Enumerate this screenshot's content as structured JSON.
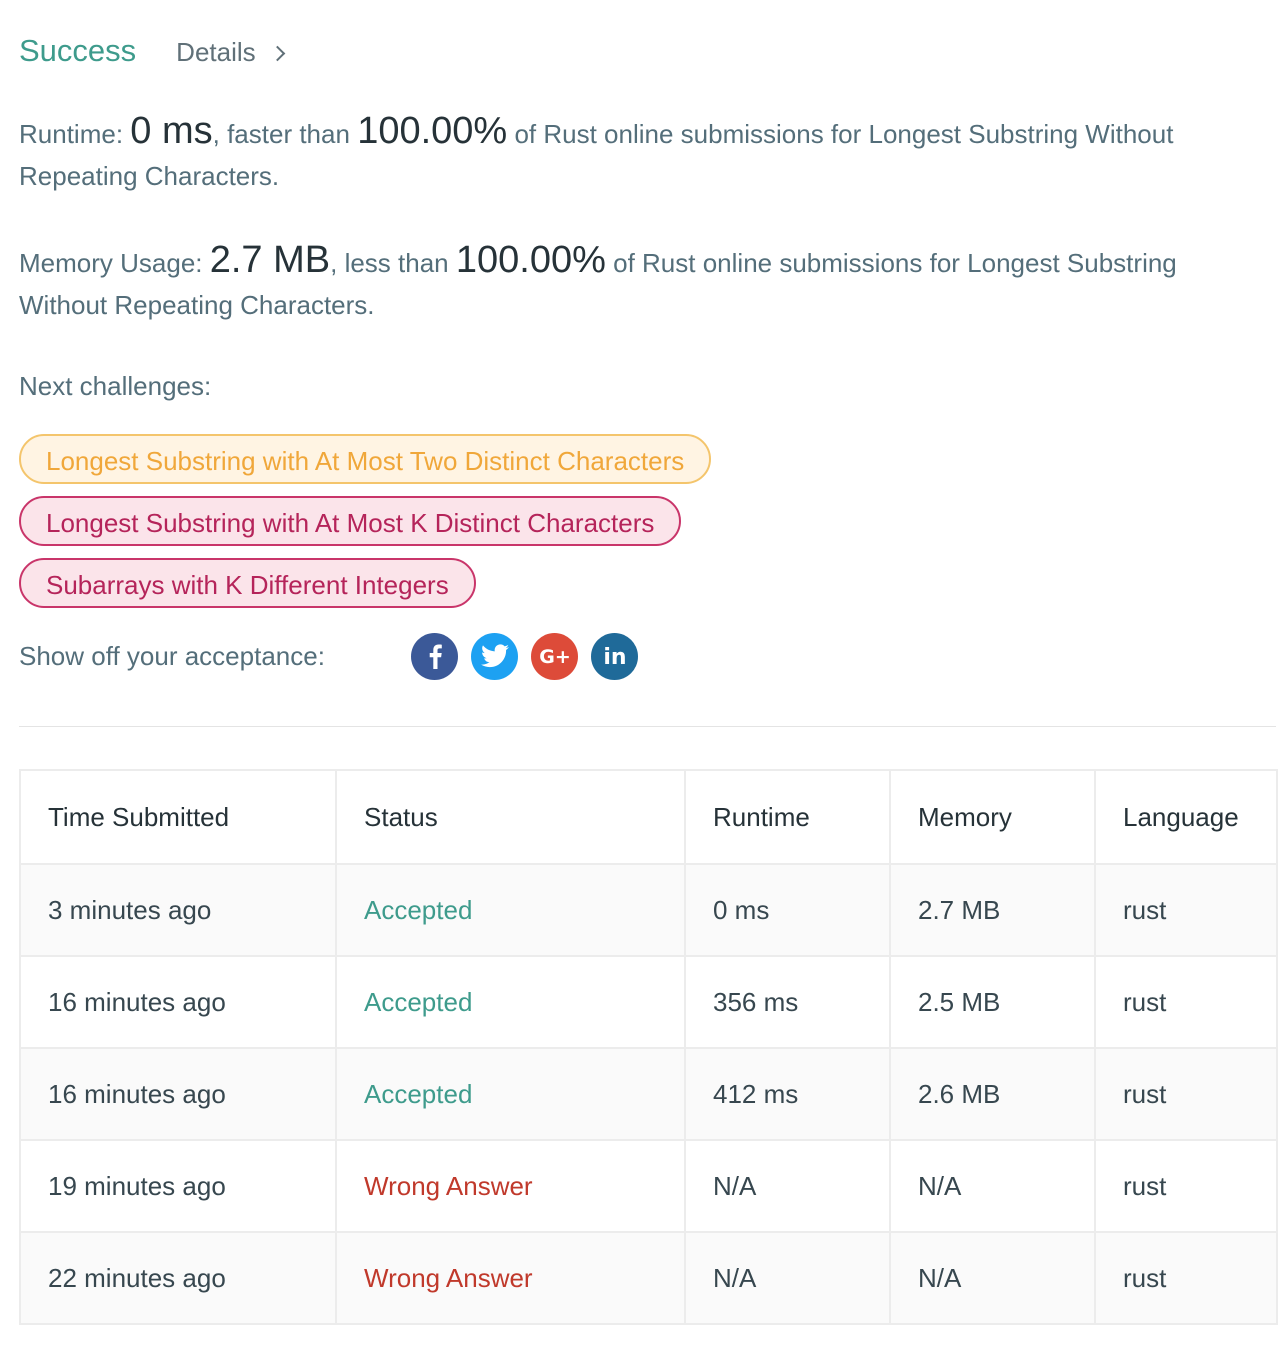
{
  "result": {
    "status": "Success",
    "details_label": "Details"
  },
  "runtime": {
    "label": "Runtime:",
    "value": "0 ms",
    "compare_text": ", faster than",
    "percent": "100.00%",
    "suffix": "of Rust online submissions for Longest Substring Without Repeating Characters."
  },
  "memory": {
    "label": "Memory Usage:",
    "value": "2.7 MB",
    "compare_text": ", less than",
    "percent": "100.00%",
    "suffix": "of Rust online submissions for Longest Substring Without Repeating Characters."
  },
  "next_challenges": {
    "label": "Next challenges:",
    "items": [
      {
        "title": "Longest Substring with At Most Two Distinct Characters",
        "difficulty_color": "#f0a73a"
      },
      {
        "title": "Longest Substring with At Most K Distinct Characters",
        "difficulty_color": "#b5245a"
      },
      {
        "title": "Subarrays with K Different Integers",
        "difficulty_color": "#b5245a"
      }
    ]
  },
  "share": {
    "label": "Show off your acceptance:",
    "icons": [
      "facebook-icon",
      "twitter-icon",
      "google-plus-icon",
      "linkedin-icon"
    ],
    "gplus_text": "G+",
    "linkedin_text": "in"
  },
  "submissions": {
    "columns": [
      "Time Submitted",
      "Status",
      "Runtime",
      "Memory",
      "Language"
    ],
    "rows": [
      {
        "time": "3 minutes ago",
        "status": "Accepted",
        "runtime": "0 ms",
        "memory": "2.7 MB",
        "language": "rust"
      },
      {
        "time": "16 minutes ago",
        "status": "Accepted",
        "runtime": "356 ms",
        "memory": "2.5 MB",
        "language": "rust"
      },
      {
        "time": "16 minutes ago",
        "status": "Accepted",
        "runtime": "412 ms",
        "memory": "2.6 MB",
        "language": "rust"
      },
      {
        "time": "19 minutes ago",
        "status": "Wrong Answer",
        "runtime": "N/A",
        "memory": "N/A",
        "language": "rust"
      },
      {
        "time": "22 minutes ago",
        "status": "Wrong Answer",
        "runtime": "N/A",
        "memory": "N/A",
        "language": "rust"
      }
    ]
  },
  "colors": {
    "success": "#3e9b8c",
    "wrong_answer": "#c0392b",
    "medium": "#f0a73a",
    "hard": "#b5245a"
  }
}
